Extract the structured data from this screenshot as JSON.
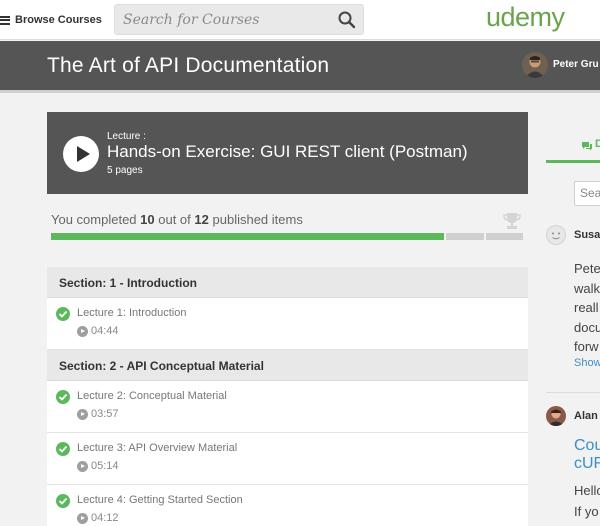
{
  "navbar": {
    "browse_label": "Browse Courses",
    "search_placeholder": "Search for Courses",
    "logo_text": "udemy",
    "logo_color": "#69a44a"
  },
  "course": {
    "title": "The Art of API Documentation",
    "user_name": "Peter Gru"
  },
  "current_lecture": {
    "kicker": "Lecture :",
    "title": "Hands-on Exercise: GUI REST client (Postman)",
    "pages": "5 pages"
  },
  "progress": {
    "prefix": "You completed",
    "completed": "10",
    "middle": "out of",
    "total": "12",
    "suffix": "published items",
    "completed_fraction": 0.8333,
    "complete_color": "#5cb85c",
    "incomplete_color": "#d0d0d0"
  },
  "curriculum": {
    "sections": [
      {
        "title": "Section: 1 - Introduction",
        "lectures": [
          {
            "title": "Lecture 1: Introduction",
            "duration": "04:44",
            "completed": true
          }
        ]
      },
      {
        "title": "Section: 2 - API Conceptual Material",
        "lectures": [
          {
            "title": "Lecture 2: Conceptual Material",
            "duration": "03:57",
            "completed": true
          },
          {
            "title": "Lecture 3: API Overview Material",
            "duration": "05:14",
            "completed": true
          },
          {
            "title": "Lecture 4: Getting Started Section",
            "duration": "04:12",
            "completed": true
          }
        ]
      }
    ]
  },
  "sidebar": {
    "tab_label": "D",
    "search_placeholder": "Sea",
    "comments": [
      {
        "author": "Susa",
        "lines": [
          "Pete",
          "walk",
          "reall",
          "docu",
          "forw"
        ],
        "show_more": "Show"
      },
      {
        "author": "Alan",
        "title_lines": [
          "Cou",
          "cUF"
        ],
        "lines": [
          "Hello",
          "If yo"
        ]
      }
    ]
  }
}
